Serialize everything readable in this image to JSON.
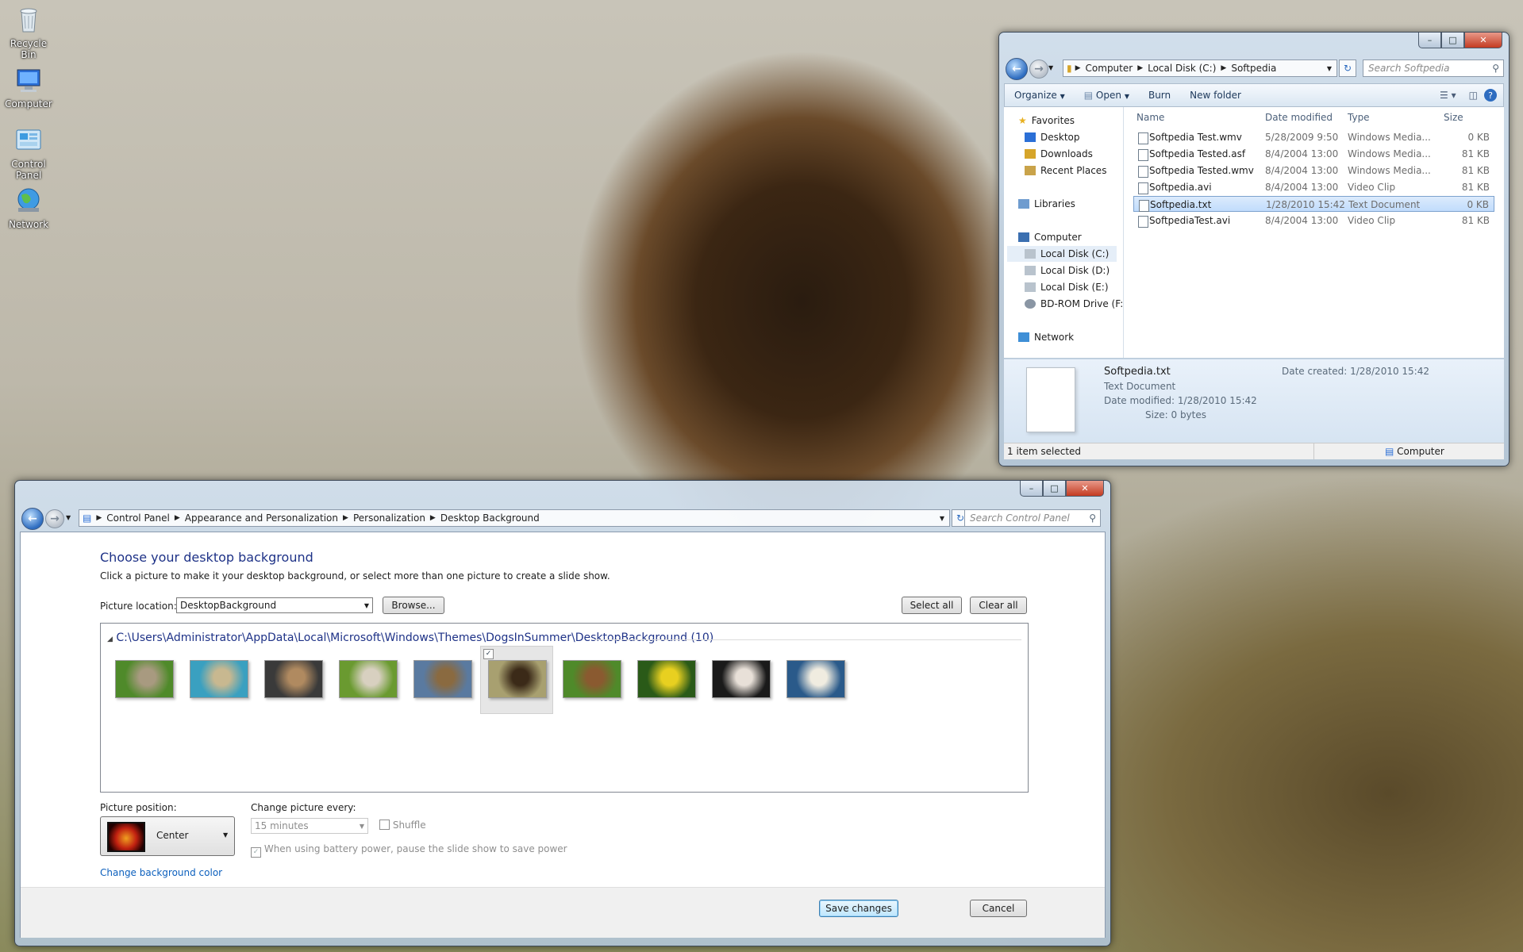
{
  "desktop": {
    "icons": [
      {
        "label": "Recycle Bin",
        "icon": "recycle-bin-icon"
      },
      {
        "label": "Computer",
        "icon": "computer-icon"
      },
      {
        "label": "Control Panel",
        "icon": "control-panel-icon"
      },
      {
        "label": "Network",
        "icon": "network-icon"
      }
    ]
  },
  "explorer": {
    "breadcrumb": [
      "Computer",
      "Local Disk (C:)",
      "Softpedia"
    ],
    "search_placeholder": "Search Softpedia",
    "toolbar": {
      "organize": "Organize",
      "open": "Open",
      "burn": "Burn",
      "new_folder": "New folder"
    },
    "nav": {
      "favorites": "Favorites",
      "desktop": "Desktop",
      "downloads": "Downloads",
      "recent": "Recent Places",
      "libraries": "Libraries",
      "computer": "Computer",
      "disk_c": "Local Disk (C:)",
      "disk_d": "Local Disk (D:)",
      "disk_e": "Local Disk (E:)",
      "bd_rom": "BD-ROM Drive (F:)",
      "network": "Network"
    },
    "columns": {
      "name": "Name",
      "date": "Date modified",
      "type": "Type",
      "size": "Size"
    },
    "files": [
      {
        "name": "Softpedia Test.wmv",
        "date": "5/28/2009 9:50",
        "type": "Windows Media...",
        "size": "0 KB"
      },
      {
        "name": "Softpedia Tested.asf",
        "date": "8/4/2004 13:00",
        "type": "Windows Media...",
        "size": "81 KB"
      },
      {
        "name": "Softpedia Tested.wmv",
        "date": "8/4/2004 13:00",
        "type": "Windows Media...",
        "size": "81 KB"
      },
      {
        "name": "Softpedia.avi",
        "date": "8/4/2004 13:00",
        "type": "Video Clip",
        "size": "81 KB"
      },
      {
        "name": "Softpedia.txt",
        "date": "1/28/2010 15:42",
        "type": "Text Document",
        "size": "0 KB"
      },
      {
        "name": "SoftpediaTest.avi",
        "date": "8/4/2004 13:00",
        "type": "Video Clip",
        "size": "81 KB"
      }
    ],
    "details": {
      "filename": "Softpedia.txt",
      "type": "Text Document",
      "date_modified": "Date modified:  1/28/2010 15:42",
      "size": "Size:  0 bytes",
      "date_created": "Date created:  1/28/2010 15:42"
    },
    "status": {
      "selected": "1 item selected",
      "zone": "Computer"
    }
  },
  "cpanel": {
    "breadcrumb": [
      "Control Panel",
      "Appearance and Personalization",
      "Personalization",
      "Desktop Background"
    ],
    "search_placeholder": "Search Control Panel",
    "heading": "Choose your desktop background",
    "instructions": "Click a picture to make it your desktop background, or select more than one picture to create a slide show.",
    "picture_location_label": "Picture location:",
    "picture_location_value": "DesktopBackground",
    "browse": "Browse...",
    "select_all": "Select all",
    "clear_all": "Clear all",
    "group_path": "C:\\Users\\Administrator\\AppData\\Local\\Microsoft\\Windows\\Themes\\DogsInSummer\\DesktopBackground (10)",
    "thumbnails": [
      {
        "colors": [
          "#4f8a2a",
          "#a89a80"
        ],
        "selected": false
      },
      {
        "colors": [
          "#3aa0c0",
          "#c8b890"
        ],
        "selected": false
      },
      {
        "colors": [
          "#3a3a3a",
          "#b08a60"
        ],
        "selected": false
      },
      {
        "colors": [
          "#6a9a30",
          "#d8d0c0"
        ],
        "selected": false
      },
      {
        "colors": [
          "#5a7aa0",
          "#8a6a40"
        ],
        "selected": false
      },
      {
        "colors": [
          "#a8a070",
          "#3b2a18"
        ],
        "selected": true
      },
      {
        "colors": [
          "#4f8a2a",
          "#8a5a30"
        ],
        "selected": false
      },
      {
        "colors": [
          "#2a5a18",
          "#e8d020"
        ],
        "selected": false
      },
      {
        "colors": [
          "#1a1a1a",
          "#e8e0d8"
        ],
        "selected": false
      },
      {
        "colors": [
          "#2a5a8a",
          "#f0ece0"
        ],
        "selected": false
      }
    ],
    "picture_position_label": "Picture position:",
    "picture_position_value": "Center",
    "change_every_label": "Change picture every:",
    "change_every_value": "15 minutes",
    "shuffle": "Shuffle",
    "battery": "When using battery power, pause the slide show to save power",
    "change_bg_color": "Change background color",
    "save": "Save changes",
    "cancel": "Cancel"
  }
}
